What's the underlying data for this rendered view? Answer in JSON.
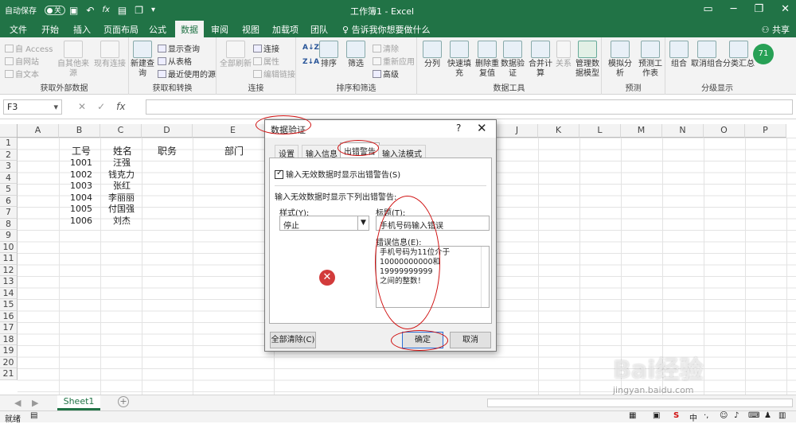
{
  "titlebar": {
    "autosave": "自动保存",
    "autosave_state": "关",
    "title": "工作簿1 - Excel"
  },
  "tabs": [
    "文件",
    "开始",
    "插入",
    "页面布局",
    "公式",
    "数据",
    "审阅",
    "视图",
    "加载项",
    "团队"
  ],
  "tell_me": "告诉我你想要做什么",
  "share": "共享",
  "avatar": "71",
  "ribbon": {
    "g1": {
      "label": "获取外部数据",
      "items": [
        "自 Access",
        "自网站",
        "自文本",
        "自其他来源",
        "现有连接"
      ]
    },
    "g2": {
      "label": "获取和转换",
      "items": [
        "新建查询",
        "显示查询",
        "从表格",
        "最近使用的源"
      ]
    },
    "g3": {
      "label": "连接",
      "items": [
        "全部刷新",
        "连接",
        "属性",
        "编辑链接"
      ]
    },
    "g4": {
      "label": "排序和筛选",
      "items": [
        "排序",
        "筛选",
        "清除",
        "重新应用",
        "高级"
      ]
    },
    "g5": {
      "label": "数据工具",
      "items": [
        "分列",
        "快速填充",
        "删除重复值",
        "数据验证",
        "合并计算",
        "关系",
        "管理数据模型"
      ]
    },
    "g6": {
      "label": "预测",
      "items": [
        "模拟分析",
        "预测工作表"
      ]
    },
    "g7": {
      "label": "分级显示",
      "items": [
        "组合",
        "取消组合",
        "分类汇总"
      ]
    }
  },
  "namebox": "F3",
  "columns": [
    "A",
    "B",
    "C",
    "D",
    "E",
    "F",
    "G",
    "H",
    "I",
    "J",
    "K",
    "L",
    "M",
    "N",
    "O",
    "P"
  ],
  "rows": [
    "1",
    "2",
    "3",
    "4",
    "5",
    "6",
    "7",
    "8",
    "9",
    "10",
    "11",
    "12",
    "13",
    "14",
    "15",
    "16",
    "17",
    "18",
    "19",
    "20",
    "21"
  ],
  "sheet": {
    "headers": {
      "b": "工号",
      "c": "姓名",
      "d": "职务",
      "e": "部门"
    },
    "records": [
      {
        "id": "1001",
        "name": "汪强"
      },
      {
        "id": "1002",
        "name": "钱克力"
      },
      {
        "id": "1003",
        "name": "张红"
      },
      {
        "id": "1004",
        "name": "李丽丽"
      },
      {
        "id": "1005",
        "name": "付国强"
      },
      {
        "id": "1006",
        "name": "刘杰"
      }
    ]
  },
  "sheet_tab": "Sheet1",
  "status": "就绪",
  "dialog": {
    "title": "数据验证",
    "help": "?",
    "tabs": [
      "设置",
      "输入信息",
      "出错警告",
      "输入法模式"
    ],
    "show_alert": "输入无效数据时显示出错警告(S)",
    "subheading": "输入无效数据时显示下列出错警告:",
    "style_label": "样式(Y):",
    "style_value": "停止",
    "title_label": "标题(T):",
    "title_value": "手机号码输入错误",
    "msg_label": "错误信息(E):",
    "msg_lines": [
      "手机号码为11位介于",
      "10000000000和19999999999",
      "之间的整数！"
    ],
    "clear_all": "全部清除(C)",
    "ok": "确定",
    "cancel": "取消"
  },
  "watermark": {
    "brand": "Bai经验",
    "url": "jingyan.baidu.com"
  },
  "colors": {
    "excel_green": "#217346",
    "annotation_red": "#d01010"
  }
}
